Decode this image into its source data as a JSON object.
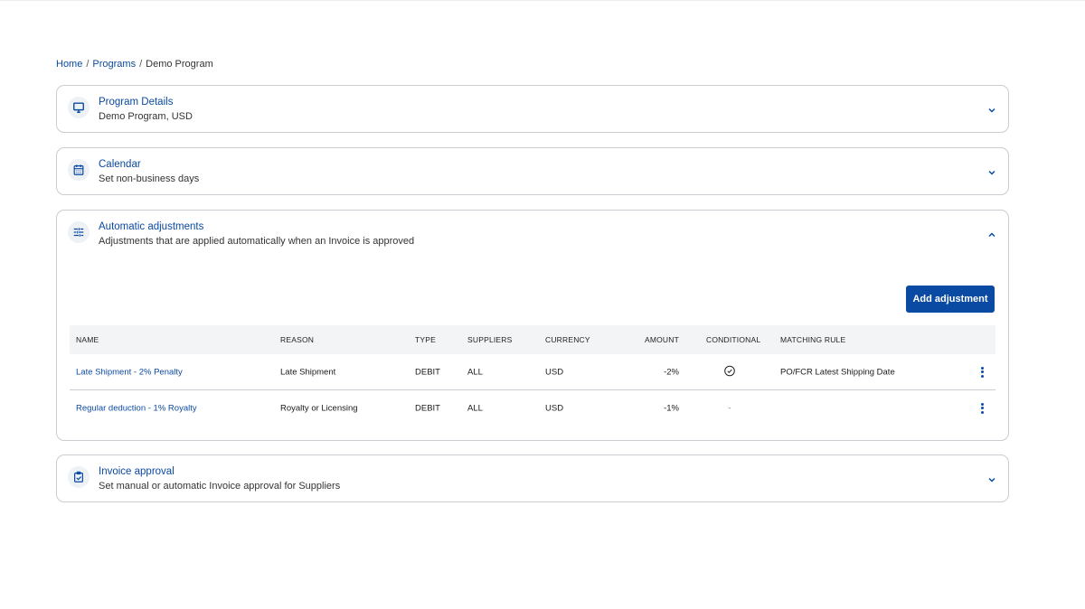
{
  "breadcrumb": {
    "home": "Home",
    "programs": "Programs",
    "current": "Demo Program",
    "separator": "/"
  },
  "sections": {
    "program_details": {
      "title": "Program Details",
      "subtitle": "Demo Program, USD",
      "icon": "monitor-icon",
      "expanded": false
    },
    "calendar": {
      "title": "Calendar",
      "subtitle": "Set non-business days",
      "icon": "calendar-icon",
      "expanded": false
    },
    "automatic_adjustments": {
      "title": "Automatic adjustments",
      "subtitle": "Adjustments that are applied automatically when an Invoice is approved",
      "icon": "sliders-icon",
      "expanded": true,
      "add_button": "Add adjustment",
      "columns": [
        "NAME",
        "REASON",
        "TYPE",
        "SUPPLIERS",
        "CURRENCY",
        "AMOUNT",
        "CONDITIONAL",
        "MATCHING RULE"
      ],
      "rows": [
        {
          "name": "Late Shipment - 2% Penalty",
          "reason": "Late Shipment",
          "type": "DEBIT",
          "suppliers": "ALL",
          "currency": "USD",
          "amount": "-2%",
          "conditional": "check-circle-icon",
          "matching_rule": "PO/FCR Latest Shipping Date"
        },
        {
          "name": "Regular deduction - 1% Royalty",
          "reason": "Royalty or Licensing",
          "type": "DEBIT",
          "suppliers": "ALL",
          "currency": "USD",
          "amount": "-1%",
          "conditional": "-",
          "matching_rule": ""
        }
      ]
    },
    "invoice_approval": {
      "title": "Invoice approval",
      "subtitle": "Set manual or automatic Invoice approval for Suppliers",
      "icon": "clipboard-check-icon",
      "expanded": false
    }
  },
  "colors": {
    "brand": "#0b4aa2",
    "border": "#c9ccd1",
    "table_header_bg": "#f3f4f6",
    "icon_bg": "#eef1f5"
  }
}
